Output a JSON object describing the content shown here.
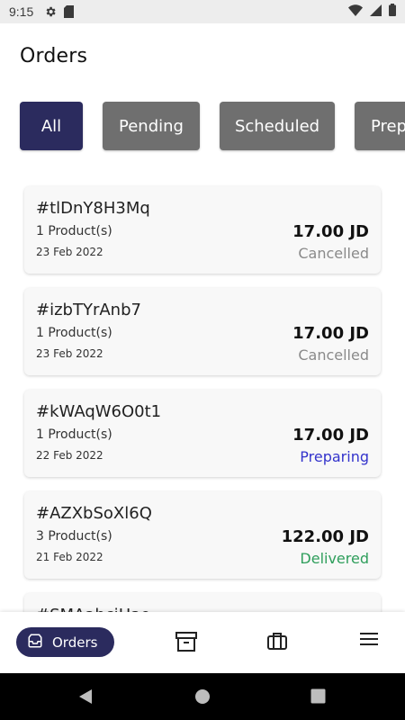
{
  "status_bar": {
    "time": "9:15",
    "icons": [
      "gear-icon",
      "sd-card-icon",
      "wifi-icon",
      "signal-icon",
      "battery-icon"
    ]
  },
  "page": {
    "title": "Orders"
  },
  "filters": {
    "chips": [
      {
        "label": "All",
        "active": true
      },
      {
        "label": "Pending",
        "active": false
      },
      {
        "label": "Scheduled",
        "active": false
      },
      {
        "label": "Prep",
        "active": false
      }
    ]
  },
  "orders": [
    {
      "id": "#tlDnY8H3Mq",
      "products": "1 Product(s)",
      "date": "23 Feb 2022",
      "price": "17.00 JD",
      "status": "Cancelled",
      "status_color": "#8a8a8a"
    },
    {
      "id": "#izbTYrAnb7",
      "products": "1 Product(s)",
      "date": "23 Feb 2022",
      "price": "17.00 JD",
      "status": "Cancelled",
      "status_color": "#8a8a8a"
    },
    {
      "id": "#kWAqW6O0t1",
      "products": "1 Product(s)",
      "date": "22 Feb 2022",
      "price": "17.00 JD",
      "status": "Preparing",
      "status_color": "#3333cc"
    },
    {
      "id": "#AZXbSoXl6Q",
      "products": "3 Product(s)",
      "date": "21 Feb 2022",
      "price": "122.00 JD",
      "status": "Delivered",
      "status_color": "#2e9e5b"
    },
    {
      "id": "#SMAahciHao",
      "products": "",
      "date": "",
      "price": "",
      "status": "",
      "status_color": "#8a8a8a"
    }
  ],
  "bottom_nav": {
    "active_label": "Orders",
    "icons": [
      "orders-inbox-icon",
      "archive-icon",
      "briefcase-icon",
      "menu-icon"
    ]
  },
  "colors": {
    "primary": "#2b2b5e",
    "chip_inactive": "#6f6f6f"
  }
}
